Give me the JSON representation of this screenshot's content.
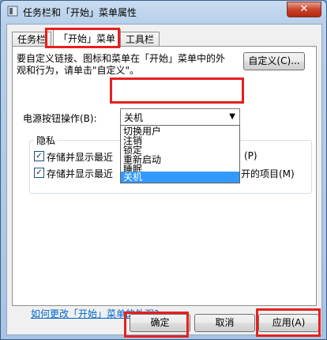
{
  "window": {
    "title": "任务栏和「开始」菜单属性",
    "close": "✕"
  },
  "tabs": [
    {
      "label": "任务栏",
      "accesskey": ""
    },
    {
      "label": "「开始」菜单",
      "accesskey": ""
    },
    {
      "label": "工具栏",
      "accesskey": ""
    }
  ],
  "start_menu": {
    "description": "要自定义链接、图标和菜单在「开始」菜单中的外观和行为，请单击\"自定义\"。",
    "customize_button": "自定义(C)...",
    "power_label": "电源按钮操作(B):",
    "power_value": "关机",
    "power_options": [
      "切换用户",
      "注销",
      "锁定",
      "重新启动",
      "睡眠",
      "关机"
    ],
    "privacy_group": "隐私",
    "privacy_items": [
      {
        "text": "存储并显示最近",
        "suffix": "(P)",
        "checked": true
      },
      {
        "text": "存储并显示最近",
        "suffix": "开的项目(M)",
        "checked": true
      }
    ],
    "help_link": "如何更改「开始」菜单的外观?"
  },
  "buttons": {
    "ok": "确定",
    "cancel": "取消",
    "apply": "应用(A)"
  },
  "colors": {
    "highlight": "#e62020",
    "selection": "#3399ff",
    "link": "#0066cc"
  }
}
